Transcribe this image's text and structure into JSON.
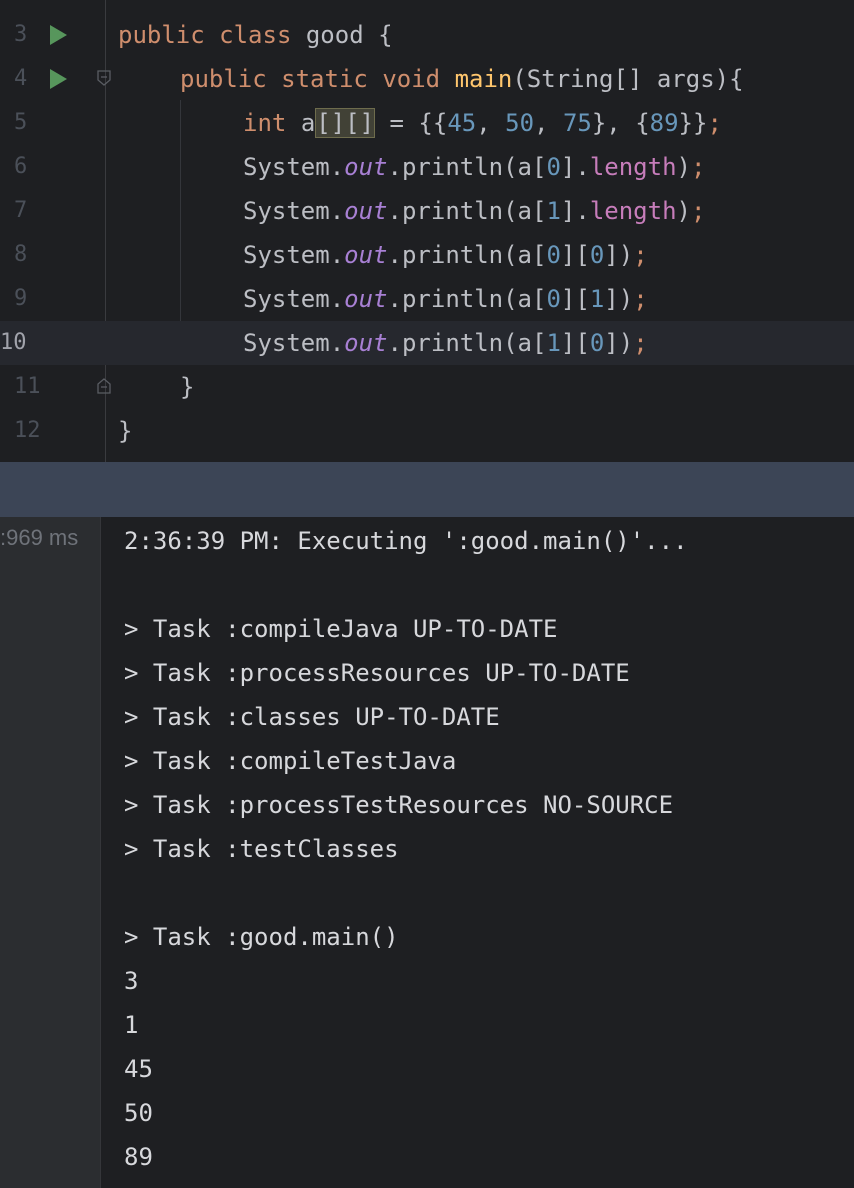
{
  "editor": {
    "lines": [
      {
        "num": "3"
      },
      {
        "num": "4"
      },
      {
        "num": "5"
      },
      {
        "num": "6"
      },
      {
        "num": "7"
      },
      {
        "num": "8"
      },
      {
        "num": "9"
      },
      {
        "num": "10"
      },
      {
        "num": "11"
      },
      {
        "num": "12"
      }
    ],
    "code": {
      "l3": {
        "kw1": "public",
        "kw2": "class",
        "name": "good",
        "brace": "{"
      },
      "l4": {
        "kw1": "public",
        "kw2": "static",
        "kw3": "void",
        "method": "main",
        "params": "(String[] args){"
      },
      "l5": {
        "type": "int",
        "var": "a",
        "brackets": "[][]",
        "eq": " = {{",
        "n1": "45",
        "c1": ", ",
        "n2": "50",
        "c2": ", ",
        "n3": "75",
        "mid": "}, {",
        "n4": "89",
        "end": "}}",
        "semi": ";"
      },
      "l6": {
        "sys": "System.",
        "out": "out",
        "call": ".println(a[",
        "idx": "0",
        "rest": "].",
        "prop": "length",
        "close": ")",
        "semi": ";"
      },
      "l7": {
        "sys": "System.",
        "out": "out",
        "call": ".println(a[",
        "idx": "1",
        "rest": "].",
        "prop": "length",
        "close": ")",
        "semi": ";"
      },
      "l8": {
        "sys": "System.",
        "out": "out",
        "call": ".println(a[",
        "i1": "0",
        "mid": "][",
        "i2": "0",
        "close": "])",
        "semi": ";"
      },
      "l9": {
        "sys": "System.",
        "out": "out",
        "call": ".println(a[",
        "i1": "0",
        "mid": "][",
        "i2": "1",
        "close": "])",
        "semi": ";"
      },
      "l10": {
        "sys": "System.",
        "out": "out",
        "call": ".println(a[",
        "i1": "1",
        "mid": "][",
        "i2": "0",
        "close": "])",
        "semi": ";"
      },
      "l11": {
        "brace": "}"
      },
      "l12": {
        "brace": "}"
      }
    }
  },
  "console": {
    "duration": ":969 ms",
    "lines": [
      "2:36:39 PM: Executing ':good.main()'...",
      "",
      "> Task :compileJava UP-TO-DATE",
      "> Task :processResources UP-TO-DATE",
      "> Task :classes UP-TO-DATE",
      "> Task :compileTestJava",
      "> Task :processTestResources NO-SOURCE",
      "> Task :testClasses",
      "",
      "> Task :good.main()",
      "3",
      "1",
      "45",
      "50",
      "89"
    ]
  },
  "colors": {
    "keyword": "#cf8e6d",
    "method": "#ffc66d",
    "number": "#6897bb",
    "field": "#a880d4",
    "run_icon": "#57965c"
  }
}
